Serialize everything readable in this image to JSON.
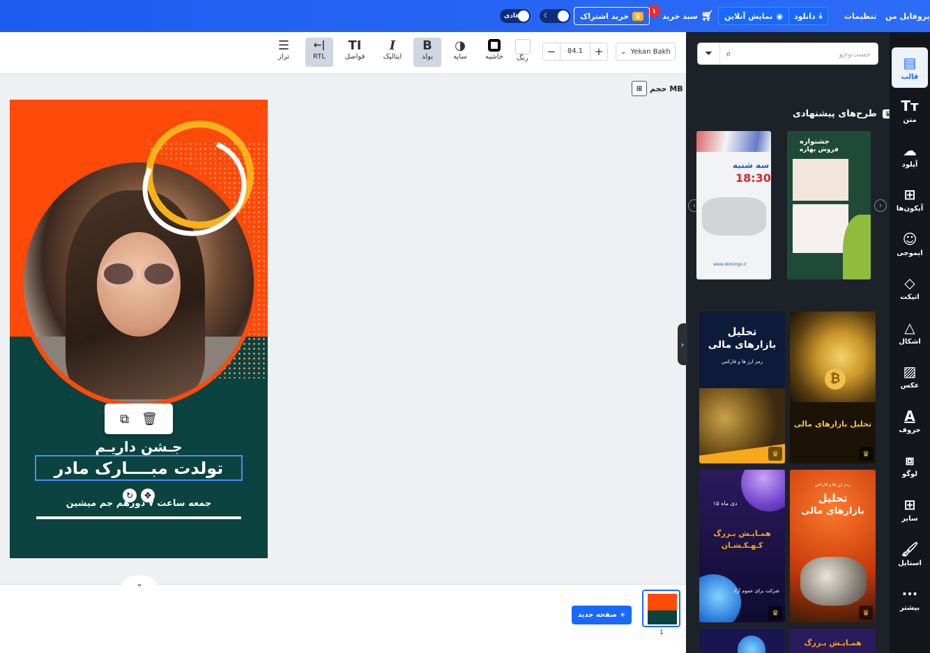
{
  "topbar": {
    "profile": "پروفایل من",
    "settings": "تنظیمات",
    "download": "دانلود",
    "online_view": "نمایش آنلاین",
    "cart": "سبد خرید",
    "cart_count": "۱",
    "subscribe": "خرید اشتراک",
    "mode_label": "عادی"
  },
  "toolbar": {
    "font": "Yekan Bakh",
    "size": "84.1",
    "minus": "−",
    "plus": "+",
    "color": "رنگ",
    "border": "حاشیه",
    "shadow": "سایه",
    "bold_icon": "B",
    "bold": "بولد",
    "italic_icon": "I",
    "italic": "ایتالیک",
    "spacing_icon": "TI",
    "spacing": "فواصل",
    "rtl_icon": "←|",
    "rtl": "RTL",
    "align": "تراز"
  },
  "canvas": {
    "size_label": "حجم MB",
    "design": {
      "line1": "جـشن داریـم",
      "line2": "تولدت مبــــارک مادر",
      "line3": "جمعه ساعت ۷ دورهم جم میشین"
    }
  },
  "bottom": {
    "new_page": "صفحه جدید",
    "page_num": "1"
  },
  "panel": {
    "search_placeholder": "جست‌وجو",
    "suggested_title": "طرح‌های پیشنهادی",
    "templates": [
      {
        "l1": "سه شنبه",
        "l2": "18:30",
        "l3": "www.domingo.ir"
      },
      {
        "l1": "جشنواره",
        "l2": "فروش بهاره"
      },
      {
        "l1": "تحلیل",
        "l2": "بازارهای مالی",
        "l3": "رمز ارز ها و فارکس"
      },
      {
        "l1": "تحلیل بازارهای مالی"
      },
      {
        "l1": "۱۵ دی ماه",
        "l2": "همـایـش بـزرگ",
        "l3": "کـهـکـشـان",
        "l4": "شرکت برای عموم آزاد"
      },
      {
        "l1": "تحلیل",
        "l2": "بازارهای مالی",
        "l3": "رمز ارز ها و فارکس"
      },
      {
        "l1": "همـایـش بـزرگ"
      }
    ]
  },
  "sidebar": {
    "items": [
      {
        "label": "قالب",
        "icon": "template-icon"
      },
      {
        "label": "متن",
        "icon": "text-icon"
      },
      {
        "label": "آپلود",
        "icon": "upload-icon"
      },
      {
        "label": "آیکون‌ها",
        "icon": "icons-icon"
      },
      {
        "label": "ایموجی",
        "icon": "emoji-icon"
      },
      {
        "label": "اتیکت",
        "icon": "tag-icon"
      },
      {
        "label": "اشکال",
        "icon": "shapes-icon"
      },
      {
        "label": "عکس",
        "icon": "image-icon"
      },
      {
        "label": "حروف",
        "icon": "letters-icon"
      },
      {
        "label": "لوگو",
        "icon": "logo-icon"
      },
      {
        "label": "سایر",
        "icon": "other-icon"
      },
      {
        "label": "استایل",
        "icon": "style-icon"
      },
      {
        "label": "بیشتر",
        "icon": "more-icon"
      }
    ]
  }
}
